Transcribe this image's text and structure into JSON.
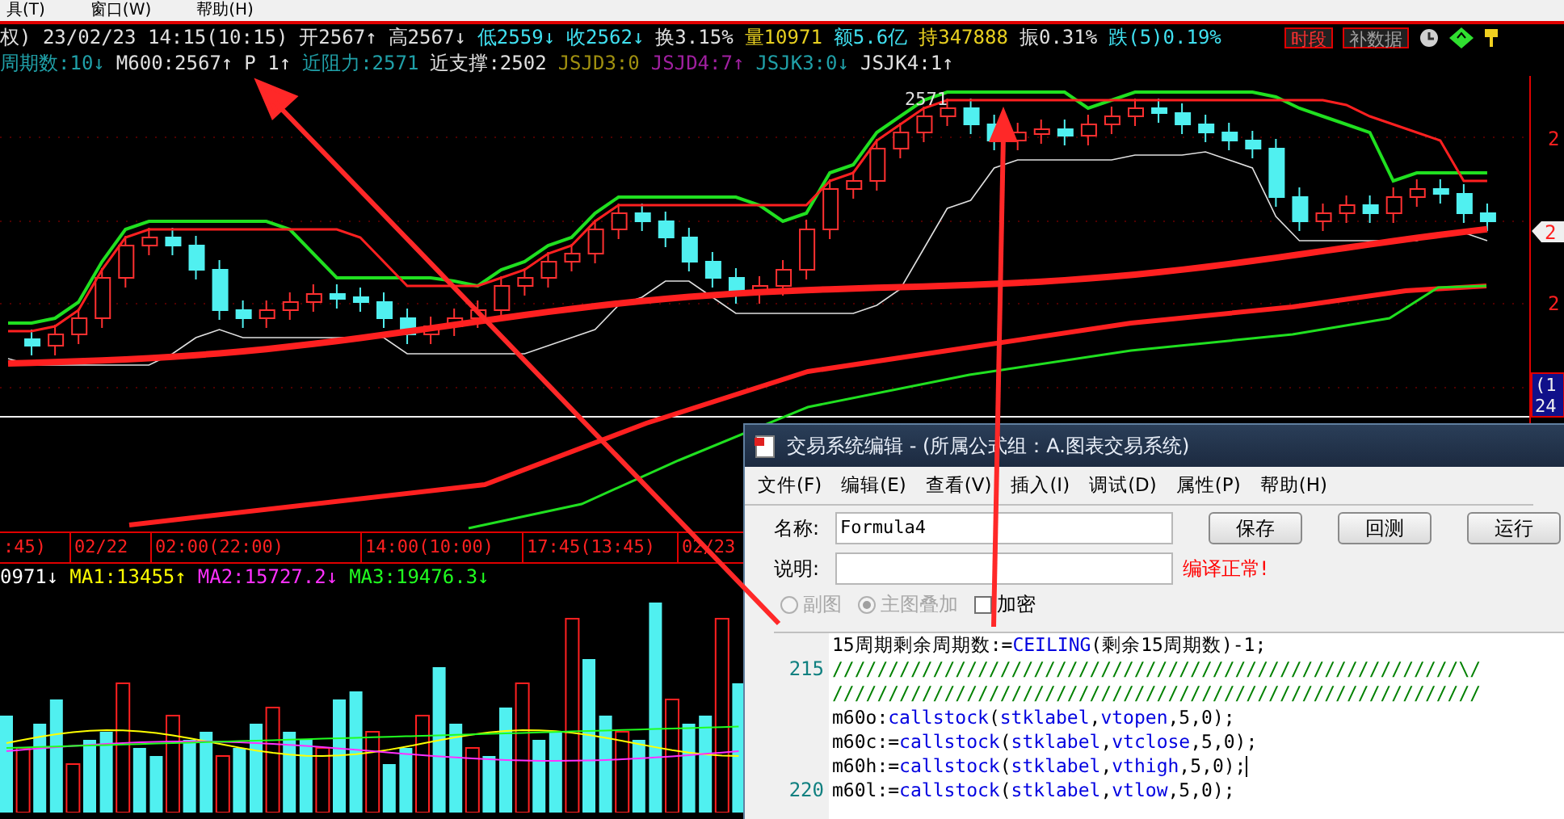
{
  "menu": [
    {
      "label": "具(T)"
    },
    {
      "label": "窗口(W)"
    },
    {
      "label": "帮助(H)"
    }
  ],
  "quote_row": [
    {
      "text": "权) 23/02/23 14:15(10:15)",
      "color": "#e0e0e0"
    },
    {
      "text": "开2567↑",
      "color": "#e0e0e0"
    },
    {
      "text": "高2567↓",
      "color": "#e0e0e0"
    },
    {
      "text": "低2559↓",
      "color": "#40e0f0"
    },
    {
      "text": "收2562↓",
      "color": "#40e0f0"
    },
    {
      "text": "换3.15%",
      "color": "#e0e0e0"
    },
    {
      "text": "量10971",
      "color": "#e8d020"
    },
    {
      "text": "额5.6亿",
      "color": "#40e0f0"
    },
    {
      "text": "持347888",
      "color": "#e8d020"
    },
    {
      "text": "振0.31%",
      "color": "#e0e0e0"
    },
    {
      "text": "跌(5)0.19%",
      "color": "#40e0f0"
    }
  ],
  "toolbar_buttons": [
    {
      "label": "时段",
      "kind": "active"
    },
    {
      "label": "补数据",
      "kind": "normal"
    }
  ],
  "indicator_row": [
    {
      "text": "周期数:10↓",
      "color": "#20a0a8"
    },
    {
      "text": "M600:2567↑",
      "color": "#e0e0e0"
    },
    {
      "text": "P 1↑",
      "color": "#e0e0e0"
    },
    {
      "text": "近阻力:2571",
      "color": "#20a0a8"
    },
    {
      "text": "近支撑:2502",
      "color": "#e0e0e0"
    },
    {
      "text": "JSJD3:0",
      "color": "#a09010"
    },
    {
      "text": "JSJD4:7↑",
      "color": "#a020a0"
    },
    {
      "text": "JSJK3:0↓",
      "color": "#20a0a8"
    },
    {
      "text": "JSJK4:1↑",
      "color": "#e0e0e0"
    }
  ],
  "chart": {
    "peak_label": "2571",
    "axis_labels": [
      "2",
      "2"
    ],
    "price_tag": "2",
    "side_box": [
      "(1",
      "24"
    ]
  },
  "time_axis": [
    ":45)",
    "02/22",
    "02:00(22:00)",
    "14:00(10:00)",
    "17:45(13:45)",
    "02/23"
  ],
  "volume_row": [
    {
      "text": "0971↓",
      "color": "#ffffff"
    },
    {
      "text": "MA1:13455↑",
      "color": "#ffff00"
    },
    {
      "text": "MA2:15727.2↓",
      "color": "#ff30ff"
    },
    {
      "text": "MA3:19476.3↓",
      "color": "#20ff20"
    }
  ],
  "dialog": {
    "title": "交易系统编辑 - (所属公式组：A.图表交易系统)",
    "menu": [
      "文件(F)",
      "编辑(E)",
      "查看(V)",
      "插入(I)",
      "调试(D)",
      "属性(P)",
      "帮助(H)"
    ],
    "name_label": "名称:",
    "name_value": "Formula4",
    "desc_label": "说明:",
    "buttons": [
      "保存",
      "回测",
      "运行"
    ],
    "status": "编译正常!",
    "options": [
      {
        "kind": "radio",
        "label": "副图",
        "selected": false,
        "disabled": true
      },
      {
        "kind": "radio",
        "label": "主图叠加",
        "selected": true,
        "disabled": true
      },
      {
        "kind": "checkbox",
        "label": "加密",
        "checked": false,
        "disabled": false
      }
    ],
    "code_lines": [
      {
        "segments": [
          {
            "kind": "plain",
            "text": "15周期剩余周期数:="
          },
          {
            "kind": "func",
            "text": "CEILING"
          },
          {
            "kind": "plain",
            "text": "(剩余15周期数)-1;"
          }
        ]
      },
      {
        "number": "215",
        "segments": [
          {
            "kind": "comment",
            "text": "////////////////////////////////////////////////////////\\/"
          }
        ]
      },
      {
        "segments": [
          {
            "kind": "comment",
            "text": "//////////////////////////////////////////////////////////"
          }
        ]
      },
      {
        "segments": [
          {
            "kind": "plain",
            "text": "m60o:"
          },
          {
            "kind": "func",
            "text": "callstock"
          },
          {
            "kind": "plain",
            "text": "("
          },
          {
            "kind": "func",
            "text": "stklabel"
          },
          {
            "kind": "plain",
            "text": ","
          },
          {
            "kind": "func",
            "text": "vtopen"
          },
          {
            "kind": "plain",
            "text": ",5,0);"
          }
        ]
      },
      {
        "segments": [
          {
            "kind": "plain",
            "text": "m60c:="
          },
          {
            "kind": "func",
            "text": "callstock"
          },
          {
            "kind": "plain",
            "text": "("
          },
          {
            "kind": "func",
            "text": "stklabel"
          },
          {
            "kind": "plain",
            "text": ","
          },
          {
            "kind": "func",
            "text": "vtclose"
          },
          {
            "kind": "plain",
            "text": ",5,0);"
          }
        ]
      },
      {
        "cursor": true,
        "segments": [
          {
            "kind": "plain",
            "text": "m60h:="
          },
          {
            "kind": "func",
            "text": "callstock"
          },
          {
            "kind": "plain",
            "text": "("
          },
          {
            "kind": "func",
            "text": "stklabel"
          },
          {
            "kind": "plain",
            "text": ","
          },
          {
            "kind": "func",
            "text": "vthigh"
          },
          {
            "kind": "plain",
            "text": ",5,0);"
          }
        ]
      },
      {
        "number": "220",
        "segments": [
          {
            "kind": "plain",
            "text": "m60l:="
          },
          {
            "kind": "func",
            "text": "callstock"
          },
          {
            "kind": "plain",
            "text": "("
          },
          {
            "kind": "func",
            "text": "stklabel"
          },
          {
            "kind": "plain",
            "text": ","
          },
          {
            "kind": "func",
            "text": "vtlow"
          },
          {
            "kind": "plain",
            "text": ",5,0);"
          }
        ]
      }
    ]
  }
}
